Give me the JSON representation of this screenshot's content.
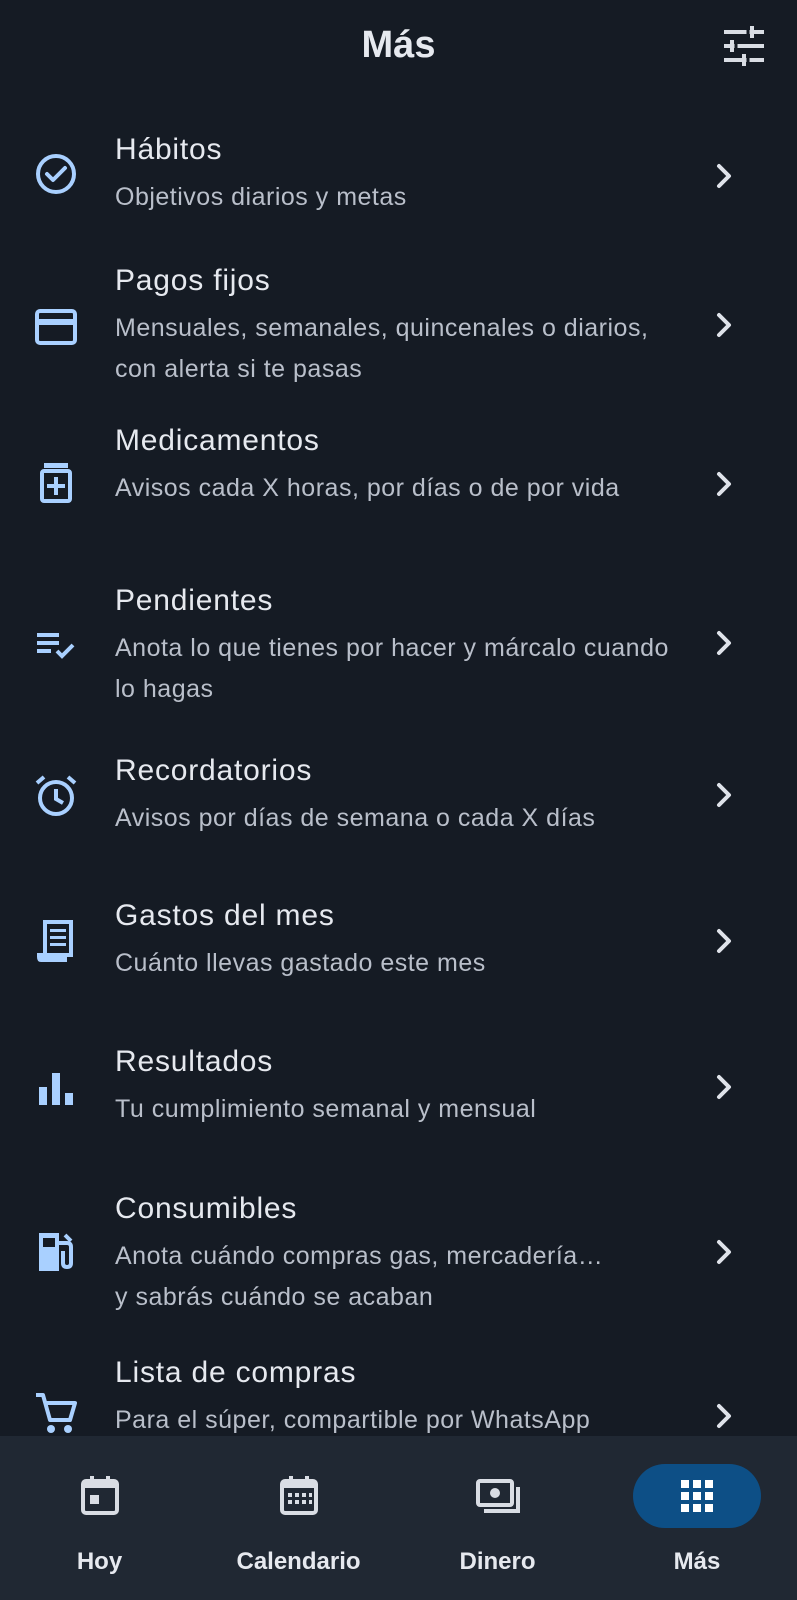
{
  "header": {
    "title": "Más"
  },
  "menu": [
    {
      "title": "Hábitos",
      "subtitle": "Objetivos diarios y metas",
      "icon": "check-circle-icon"
    },
    {
      "title": "Pagos fijos",
      "subtitle": "Mensuales, semanales, quincenales o diarios, con alerta si te pasas",
      "icon": "credit-card-icon"
    },
    {
      "title": "Medicamentos",
      "subtitle": "Avisos cada X horas, por días o de por vida",
      "icon": "medication-icon"
    },
    {
      "title": "Pendientes",
      "subtitle": "Anota lo que tienes por hacer y márcalo cuando lo hagas",
      "icon": "checklist-icon"
    },
    {
      "title": "Recordatorios",
      "subtitle": "Avisos por días de semana o cada X días",
      "icon": "alarm-icon"
    },
    {
      "title": "Gastos del mes",
      "subtitle": "Cuánto llevas gastado este mes",
      "icon": "receipt-icon"
    },
    {
      "title": "Resultados",
      "subtitle": "Tu cumplimiento semanal y mensual",
      "icon": "bar-chart-icon"
    },
    {
      "title": "Consumibles",
      "subtitle": "Anota cuándo compras gas, mercadería…\ny sabrás cuándo se acaban",
      "icon": "fuel-icon"
    },
    {
      "title": "Lista de compras",
      "subtitle": "Para el súper, compartible por WhatsApp",
      "icon": "shopping-cart-icon"
    }
  ],
  "nav": [
    {
      "label": "Hoy",
      "icon": "today-icon",
      "active": false
    },
    {
      "label": "Calendario",
      "icon": "calendar-icon",
      "active": false
    },
    {
      "label": "Dinero",
      "icon": "money-icon",
      "active": false
    },
    {
      "label": "Más",
      "icon": "apps-grid-icon",
      "active": true
    }
  ],
  "colors": {
    "background": "#151b24",
    "icon_accent": "#a9d0ff",
    "nav_background": "#202833",
    "active_pill": "#0d4f86"
  }
}
